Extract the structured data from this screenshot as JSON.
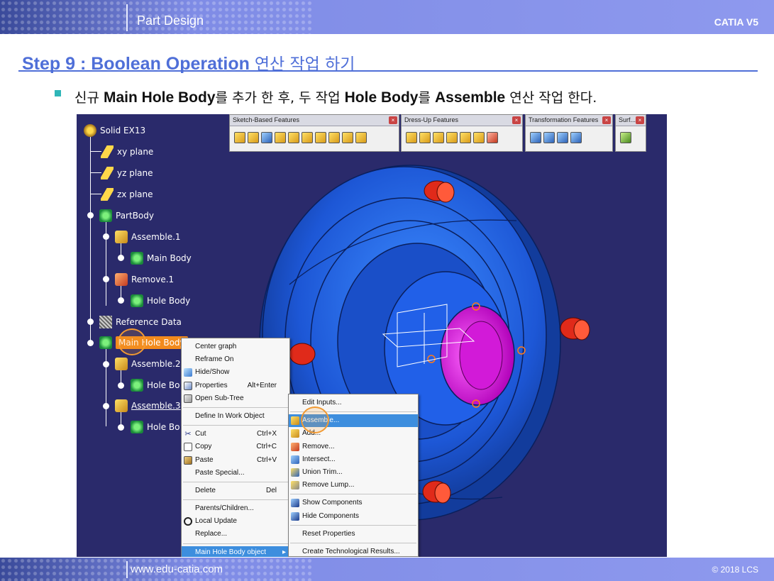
{
  "header": {
    "title": "Part Design",
    "brand": "CATIA V5"
  },
  "step": {
    "prefix": "Step 9 : Boolean Operation",
    "suffix": "연산 작업 하기"
  },
  "bullet": {
    "p1": "신규 ",
    "b1": "Main Hole Body",
    "p2": "를 추가 한 후, 두 작업 ",
    "b2": "Hole Body",
    "p3": "를 ",
    "b3": "Assemble",
    "p4": " 연산 작업 한다."
  },
  "tree": {
    "root": "Solid EX13",
    "xy": "xy plane",
    "yz": "yz plane",
    "zx": "zx plane",
    "partbody": "PartBody",
    "assemble1": "Assemble.1",
    "mainbody": "Main Body",
    "remove1": "Remove.1",
    "holebody1": "Hole Body",
    "refdata": "Reference Data",
    "mainholebody": "Main Hole Body",
    "assemble2": "Assemble.2",
    "holebody2": "Hole Bo",
    "assemble3": "Assemble.3",
    "holebody3": "Hole Bo"
  },
  "toolbars": {
    "sketch": "Sketch-Based Features",
    "dressup": "Dress-Up Features",
    "transform": "Transformation Features",
    "surf": "Surf..."
  },
  "menu1": {
    "center_graph": "Center graph",
    "reframe_on": "Reframe On",
    "hide_show": "Hide/Show",
    "properties": "Properties",
    "properties_sc": "Alt+Enter",
    "open_subtree": "Open Sub-Tree",
    "define_work": "Define In Work Object",
    "cut": "Cut",
    "cut_sc": "Ctrl+X",
    "copy": "Copy",
    "copy_sc": "Ctrl+C",
    "paste": "Paste",
    "paste_sc": "Ctrl+V",
    "paste_special": "Paste Special...",
    "delete": "Delete",
    "delete_sc": "Del",
    "parents_children": "Parents/Children...",
    "local_update": "Local Update",
    "replace": "Replace...",
    "object": "Main Hole Body object"
  },
  "menu2": {
    "edit_inputs": "Edit Inputs...",
    "assemble": "Assemble...",
    "add": "Add...",
    "remove": "Remove...",
    "intersect": "Intersect...",
    "union_trim": "Union Trim...",
    "remove_lump": "Remove Lump...",
    "show_components": "Show Components",
    "hide_components": "Hide Components",
    "reset_properties": "Reset Properties",
    "create_tech": "Create Technological Results..."
  },
  "footer": {
    "url": "www.edu-catia.com",
    "copyright": "© 2018 LCS"
  },
  "colors": {
    "accent": "#4f6fd8",
    "highlight": "#f28a1c",
    "viewport_bg": "#2a2a6b",
    "part_blue": "#1f5fe0",
    "hole_magenta": "#ee22ee",
    "peg_red": "#e02a1a"
  }
}
